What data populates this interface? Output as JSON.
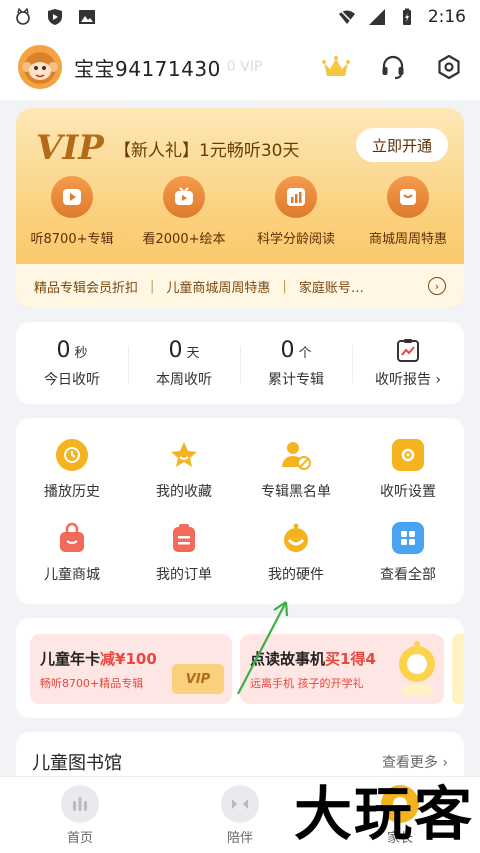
{
  "status_bar": {
    "time": "2:16"
  },
  "profile": {
    "username": "宝宝94171430",
    "ghost_text": "0  VIP"
  },
  "vip": {
    "logo": "VIP",
    "promo": "【新人礼】1元畅听30天",
    "button": "立即开通",
    "benefits": [
      {
        "label": "听8700+专辑",
        "icon": "play-icon"
      },
      {
        "label": "看2000+绘本",
        "icon": "tv-icon"
      },
      {
        "label": "科学分龄阅读",
        "icon": "chart-icon"
      },
      {
        "label": "商城周周特惠",
        "icon": "shop-icon"
      }
    ],
    "strip": {
      "item1": "精品专辑会员折扣",
      "item2": "儿童商城周周特惠",
      "item3": "家庭账号…",
      "sep": "|"
    }
  },
  "stats": [
    {
      "value": "0",
      "unit": "秒",
      "label": "今日收听"
    },
    {
      "value": "0",
      "unit": "天",
      "label": "本周收听"
    },
    {
      "value": "0",
      "unit": "个",
      "label": "累计专辑"
    }
  ],
  "report": {
    "label": "收听报告 ›"
  },
  "grid": [
    {
      "label": "播放历史",
      "icon": "clock-icon",
      "color": "#f6b320"
    },
    {
      "label": "我的收藏",
      "icon": "star-icon",
      "color": "#f6b320"
    },
    {
      "label": "专辑黑名单",
      "icon": "block-user-icon",
      "color": "#f6b320"
    },
    {
      "label": "收听设置",
      "icon": "settings-icon",
      "color": "#f6b320"
    },
    {
      "label": "儿童商城",
      "icon": "bag-icon",
      "color": "#f26a5a"
    },
    {
      "label": "我的订单",
      "icon": "order-icon",
      "color": "#f26a5a"
    },
    {
      "label": "我的硬件",
      "icon": "device-icon",
      "color": "#f6b320"
    },
    {
      "label": "查看全部",
      "icon": "apps-icon",
      "color": "#4aa3f0"
    }
  ],
  "promos": [
    {
      "title": "儿童年卡",
      "highlight": "减¥100",
      "subtitle": "畅听8700+精品专辑",
      "badge": "VIP"
    },
    {
      "title": "点读故事机",
      "highlight": "买1得4",
      "subtitle": "远离手机  孩子的开学礼"
    }
  ],
  "library": {
    "title": "儿童图书馆",
    "more": "查看更多 ›"
  },
  "tabs": [
    {
      "label": "首页"
    },
    {
      "label": "陪伴"
    },
    {
      "label": "家长"
    }
  ],
  "watermark": "大玩客",
  "colors": {
    "accent": "#f6b320",
    "vip_dark": "#5c2f06",
    "promo_red": "#e8473f",
    "arrow": "#3cb043"
  }
}
